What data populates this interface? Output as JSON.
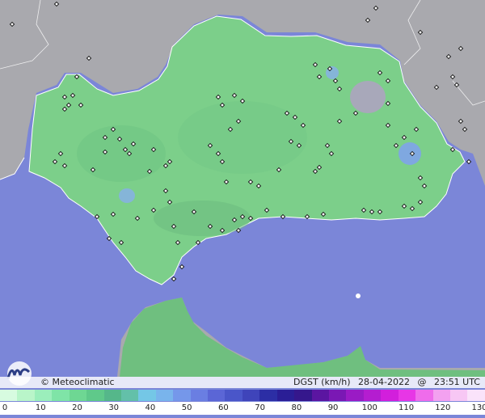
{
  "map": {
    "credit": "© Meteoclimatic",
    "variable": "DGST (km/h)",
    "date": "28-04-2022",
    "at": "@",
    "time": "23:51 UTC",
    "colors": {
      "sea": "#7b86d8",
      "land_outside": "#a9a9ae",
      "region_fill": "#7ccf8a",
      "region_dark": "#5fae73",
      "hotspot_blue": "#7fa8e0",
      "hotspot_grey": "#a8a8ba"
    },
    "legend": {
      "ticks": [
        "0",
        "10",
        "20",
        "30",
        "40",
        "50",
        "60",
        "70",
        "80",
        "90",
        "100",
        "110",
        "120",
        "130"
      ],
      "colors": [
        "#d7fbe0",
        "#b9f5c9",
        "#9beebb",
        "#7fe4a7",
        "#6ed793",
        "#5fc98a",
        "#55b78a",
        "#63c0a9",
        "#74c7e6",
        "#79b4ec",
        "#7597ea",
        "#6a7ee2",
        "#5b66d6",
        "#4a56c9",
        "#3f44ba",
        "#2c2ea5",
        "#2a1e96",
        "#35178c",
        "#5b15a1",
        "#7a18b4",
        "#9a1bc5",
        "#b41dd0",
        "#d21fdc",
        "#e736e6",
        "#ef6ceb",
        "#f3a1f0",
        "#f7c7f4",
        "#fae3fa"
      ]
    }
  }
}
